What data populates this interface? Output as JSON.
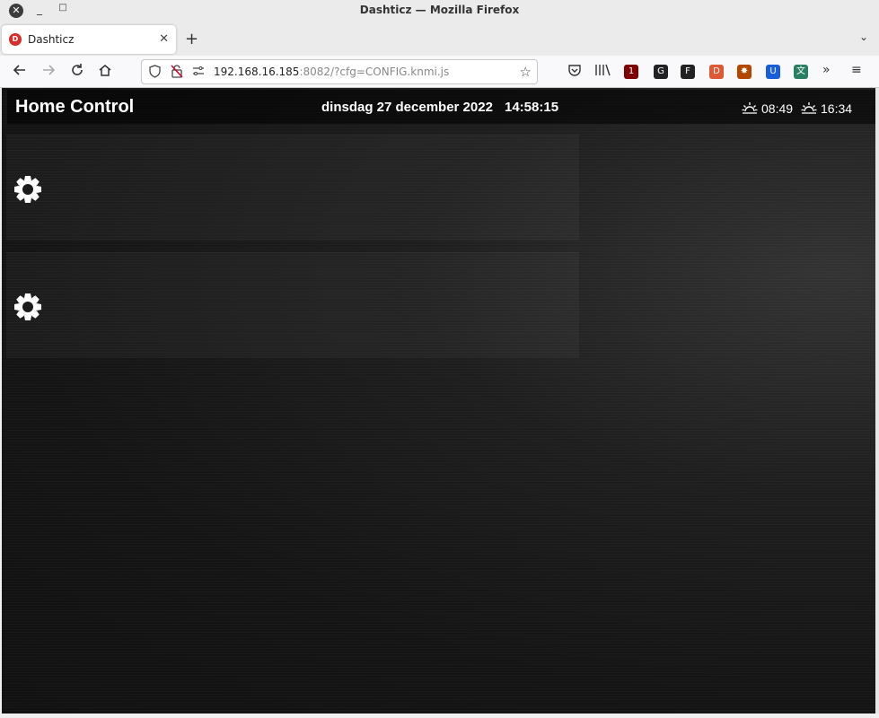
{
  "window": {
    "title": "Dashticz — Mozilla Firefox",
    "close_glyph": "✕",
    "min_glyph": "_",
    "max_glyph": "□"
  },
  "tab": {
    "favicon_text": "D",
    "title": "Dashticz",
    "close_glyph": "✕",
    "new_tab_glyph": "+",
    "list_glyph": "⌄"
  },
  "nav": {
    "url_host": "192.168.16.185",
    "url_rest": ":8082/?cfg=CONFIG.knmi.js",
    "extensions": [
      {
        "name": "ublock-icon",
        "label": "1",
        "color": "#800000"
      },
      {
        "name": "gnome-icon",
        "label": "G",
        "color": "#222222"
      },
      {
        "name": "f-icon",
        "label": "F",
        "color": "#222222"
      },
      {
        "name": "duckduckgo-icon",
        "label": "D",
        "color": "#de5833"
      },
      {
        "name": "settings-ext-icon",
        "label": "✸",
        "color": "#b34700"
      },
      {
        "name": "bitwarden-icon",
        "label": "U",
        "color": "#175ddc"
      },
      {
        "name": "translate-icon",
        "label": "文",
        "color": "#2a7f62"
      }
    ]
  },
  "page": {
    "brand": "Home Control",
    "date": "dinsdag 27 december 2022",
    "time": "14:58:15",
    "sunrise": "08:49",
    "sunset": "16:34"
  },
  "icons": {
    "sunrise": "sunrise-icon",
    "sunset": "sunset-icon",
    "gear": "gear-icon"
  }
}
